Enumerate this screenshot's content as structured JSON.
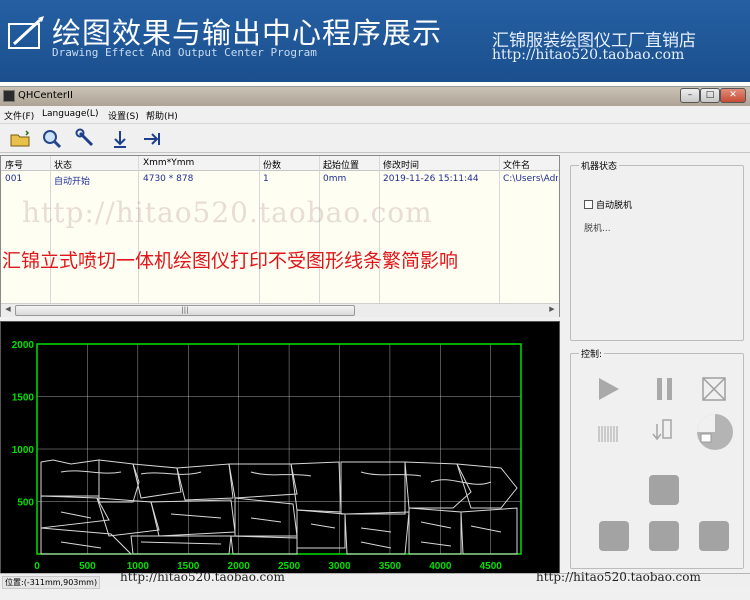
{
  "banner": {
    "title": "绘图效果与输出中心程序展示",
    "subtitle": "Drawing Effect And Output Center Program",
    "shop_name": "汇锦服装绘图仪工厂直销店",
    "shop_url": "http://hitao520.taobao.com"
  },
  "window": {
    "title": "QHCenterII",
    "controls": {
      "minimize": "–",
      "maximize": "□",
      "close": "✕"
    }
  },
  "menu": [
    {
      "label": "文件(F)"
    },
    {
      "label": "Language(L)"
    },
    {
      "label": "设置(S)"
    },
    {
      "label": "帮助(H)"
    }
  ],
  "toolbar": {
    "icons": [
      "open-folder-icon",
      "zoom-icon",
      "wrench-icon",
      "download-arrow-icon",
      "send-arrow-icon"
    ]
  },
  "table": {
    "columns": [
      "序号",
      "状态",
      "Xmm*Ymm",
      "份数",
      "起始位置",
      "修改时间",
      "文件名"
    ],
    "rows": [
      {
        "seq": "001",
        "status": "自动开始",
        "size": "4730 * 878",
        "copies": "1",
        "start": "0mm",
        "modified": "2019-11-26 15:11:44",
        "file": "C:\\Users\\Adr"
      }
    ],
    "scrollbar_grip": "|||"
  },
  "machine_status": {
    "label": "机器状态",
    "auto_eject_label": "自动脱机",
    "auto_eject_checked": false,
    "eject_text": "脱机..."
  },
  "control": {
    "label": "控制:",
    "icons": [
      "play-icon",
      "pause-icon",
      "stop-icon",
      "cut-pattern-icon",
      "pen-down-icon",
      "speed-dial-icon",
      "move-up-button",
      "move-left-button",
      "move-down-button",
      "move-right-button"
    ]
  },
  "plot": {
    "x_ticks": [
      "0",
      "500",
      "1000",
      "1500",
      "2000",
      "2500",
      "3000",
      "3500",
      "4000",
      "4500"
    ],
    "y_ticks": [
      "2000",
      "1500",
      "1000",
      "500"
    ],
    "axis_color": "#00e000",
    "grid_color": "#cfcfcf"
  },
  "status_bar": {
    "position": "位置:(-311mm,903mm)"
  },
  "watermarks": {
    "middle": "http://hitao520.taobao.com",
    "bottom_left": "http://hitao520.taobao.com",
    "bottom_right": "http://hitao520.taobao.com"
  },
  "promo_text": "汇锦立式喷切一体机绘图仪打印不受图形线条繁简影响"
}
